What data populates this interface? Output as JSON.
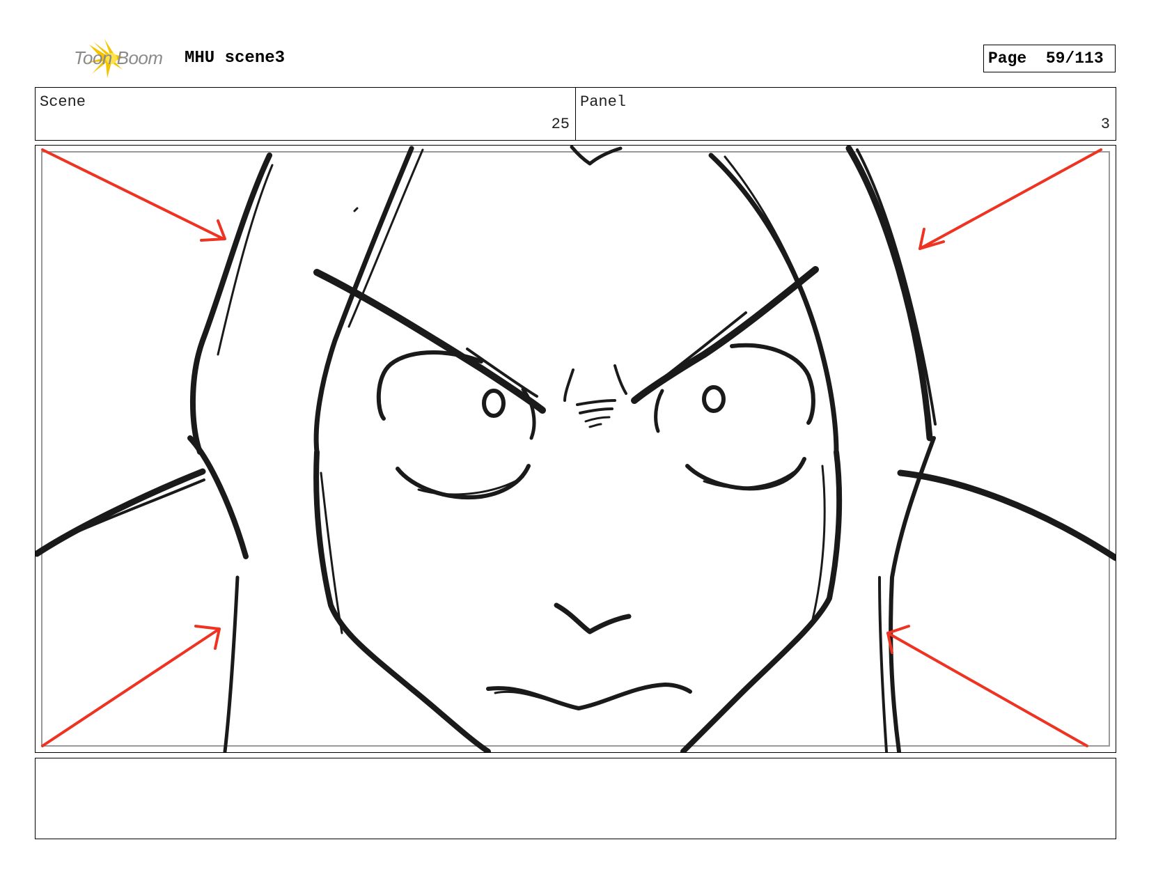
{
  "header": {
    "logo_text": "Toon Boom",
    "project_title": "MHU scene3",
    "page_label": "Page",
    "page_number": "59/113"
  },
  "info": {
    "scene_label": "Scene",
    "scene_value": "25",
    "panel_label": "Panel",
    "panel_value": "3"
  },
  "colors": {
    "arrow": "#ee3322",
    "ink": "#1a1a1a",
    "logo_yellow": "#f5c400"
  },
  "notes": {
    "text": ""
  }
}
